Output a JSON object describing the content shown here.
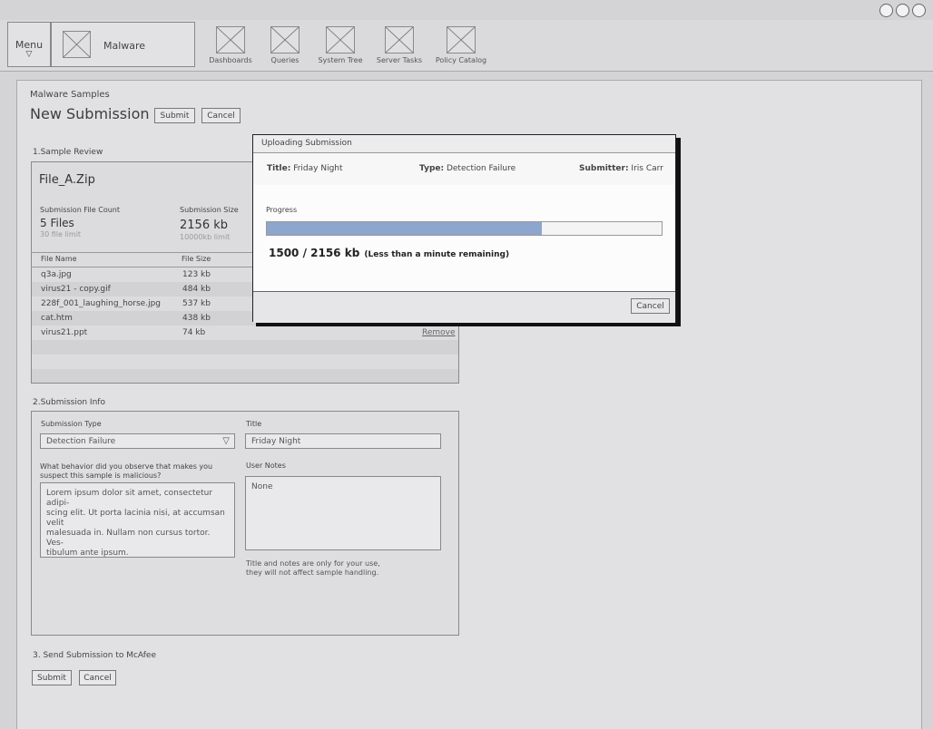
{
  "nav": {
    "menu_label": "Menu",
    "menu_arrow": "▽",
    "brand": "Malware",
    "items": [
      {
        "label": "Dashboards"
      },
      {
        "label": "Queries"
      },
      {
        "label": "System Tree"
      },
      {
        "label": "Server Tasks"
      },
      {
        "label": "Policy Catalog"
      }
    ]
  },
  "page": {
    "breadcrumb": "Malware Samples",
    "title": "New Submission",
    "submit_label": "Submit",
    "cancel_label": "Cancel"
  },
  "review": {
    "heading": "1.Sample Review",
    "file_name": "File_A.Zip",
    "count_label": "Submission File Count",
    "count_value": "5 Files",
    "count_limit": "30 file limit",
    "size_label": "Submission Size",
    "size_value": "2156 kb",
    "size_limit": "10000kb limit",
    "col_name": "File Name",
    "col_size": "File Size",
    "remove_label": "Remove",
    "files": [
      {
        "name": "q3a.jpg",
        "size": "123 kb"
      },
      {
        "name": "virus21 - copy.gif",
        "size": "484 kb"
      },
      {
        "name": "228f_001_laughing_horse.jpg",
        "size": "537 kb"
      },
      {
        "name": "cat.htm",
        "size": "438 kb"
      },
      {
        "name": "virus21.ppt",
        "size": "74 kb"
      }
    ]
  },
  "info": {
    "heading": "2.Submission Info",
    "type_label": "Submission Type",
    "type_value": "Detection Failure",
    "type_arrow": "▽",
    "title_label": "Title",
    "title_value": "Friday Night",
    "behavior_question_1": "What behavior did you observe that makes you",
    "behavior_question_2": "suspect this sample is malicious?",
    "behavior_lines": [
      "Lorem ipsum dolor sit amet, consectetur adipi-",
      "scing elit. Ut porta lacinia nisi, at accumsan velit",
      "malesuada in. Nullam non cursus tortor. Ves-",
      "tibulum ante ipsum."
    ],
    "notes_label": "User Notes",
    "notes_value": "None",
    "notes_hint_1": "Title and notes are only for your use,",
    "notes_hint_2": "they will not affect sample handling."
  },
  "send": {
    "heading": "3. Send Submission to McAfee",
    "submit_label": "Submit",
    "cancel_label": "Cancel"
  },
  "modal": {
    "title": "Uploading  Submission",
    "meta_title_label": "Title:",
    "meta_title_value": "Friday Night",
    "meta_type_label": "Type:",
    "meta_type_value": "Detection Failure",
    "meta_submitter_label": "Submitter:",
    "meta_submitter_value": "Iris Carr",
    "progress_label": "Progress",
    "progress_fraction": 0.6957,
    "progress_text": "1500 / 2156 kb",
    "progress_remaining": "(Less than a minute remaining)",
    "cancel_label": "Cancel"
  },
  "colors": {
    "progress_fill": "#8ea5cd"
  }
}
